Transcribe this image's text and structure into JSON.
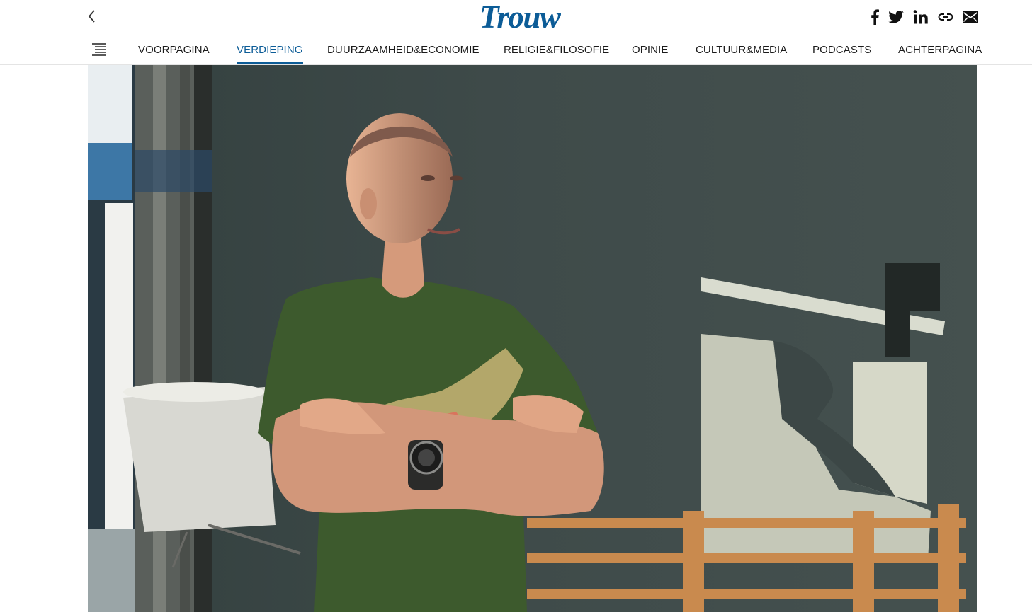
{
  "header": {
    "back_icon": "chevron-left-icon",
    "logo_text": "Trouw",
    "brand_color": "#0c5c97",
    "social": [
      {
        "name": "facebook",
        "icon": "facebook-icon"
      },
      {
        "name": "twitter",
        "icon": "twitter-icon"
      },
      {
        "name": "linkedin",
        "icon": "linkedin-icon"
      },
      {
        "name": "link",
        "icon": "link-icon"
      },
      {
        "name": "email",
        "icon": "mail-icon"
      }
    ]
  },
  "nav": {
    "menu_icon": "menu-list-icon",
    "items": [
      {
        "label": "VOORPAGINA",
        "active": false
      },
      {
        "label": "VERDIEPING",
        "active": true
      },
      {
        "label": "DUURZAAMHEID&ECONOMIE",
        "active": false
      },
      {
        "label": "RELIGIE&FILOSOFIE",
        "active": false
      },
      {
        "label": "OPINIE",
        "active": false
      },
      {
        "label": "CULTUUR&MEDIA",
        "active": false
      },
      {
        "label": "PODCASTS",
        "active": false
      },
      {
        "label": "ACHTERPAGINA",
        "active": false
      }
    ]
  }
}
